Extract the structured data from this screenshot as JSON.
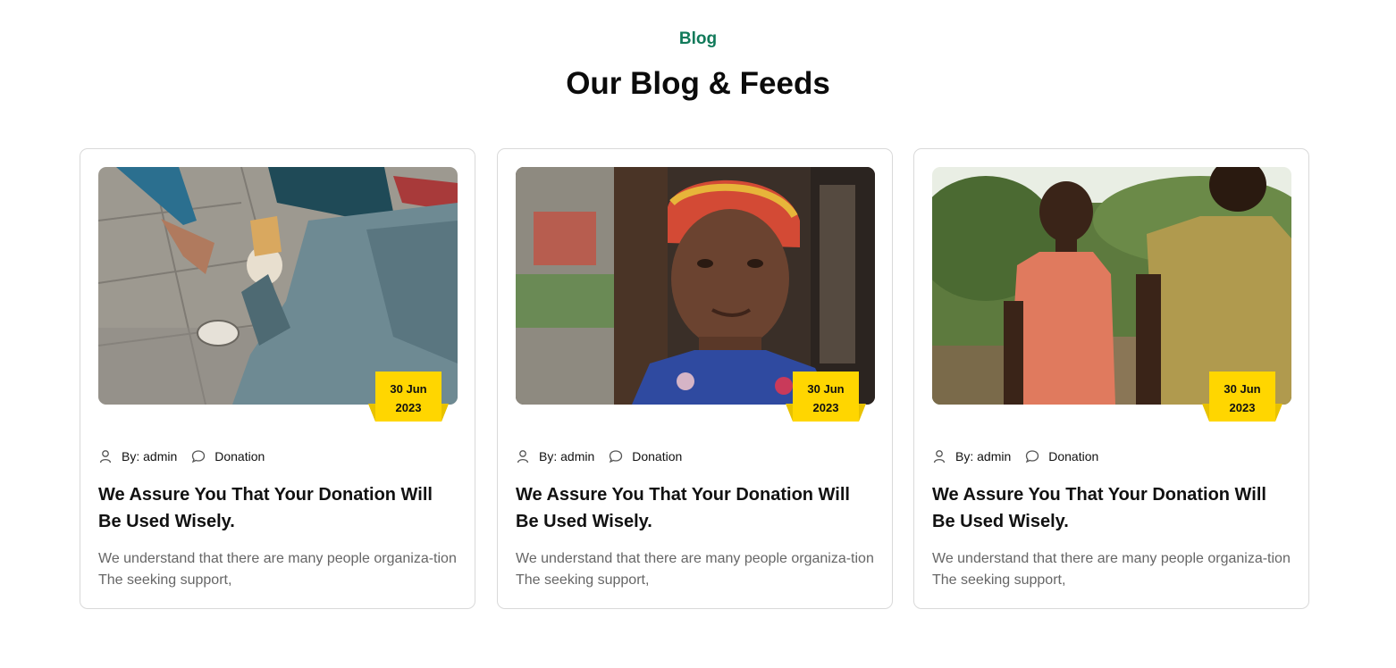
{
  "section": {
    "eyebrow": "Blog",
    "heading": "Our Blog & Feeds"
  },
  "theme": {
    "accent_green": "#117a5a",
    "badge_yellow": "#ffd600",
    "border": "#d9d9d9"
  },
  "posts": [
    {
      "image_icon": "photo-person-receiving-food",
      "date_day": "30 Jun",
      "date_year": "2023",
      "author": "By: admin",
      "category": "Donation",
      "title": "We Assure You That Your Donation Will Be Used Wisely.",
      "excerpt": "We understand that there are many people organiza-tion The seeking support,"
    },
    {
      "image_icon": "photo-woman-portrait",
      "date_day": "30 Jun",
      "date_year": "2023",
      "author": "By: admin",
      "category": "Donation",
      "title": "We Assure You That Your Donation Will Be Used Wisely.",
      "excerpt": "We understand that there are many people organiza-tion The seeking support,"
    },
    {
      "image_icon": "photo-boys-walking",
      "date_day": "30 Jun",
      "date_year": "2023",
      "author": "By: admin",
      "category": "Donation",
      "title": "We Assure You That Your Donation Will Be Used Wisely.",
      "excerpt": "We understand that there are many people organiza-tion The seeking support,"
    }
  ]
}
